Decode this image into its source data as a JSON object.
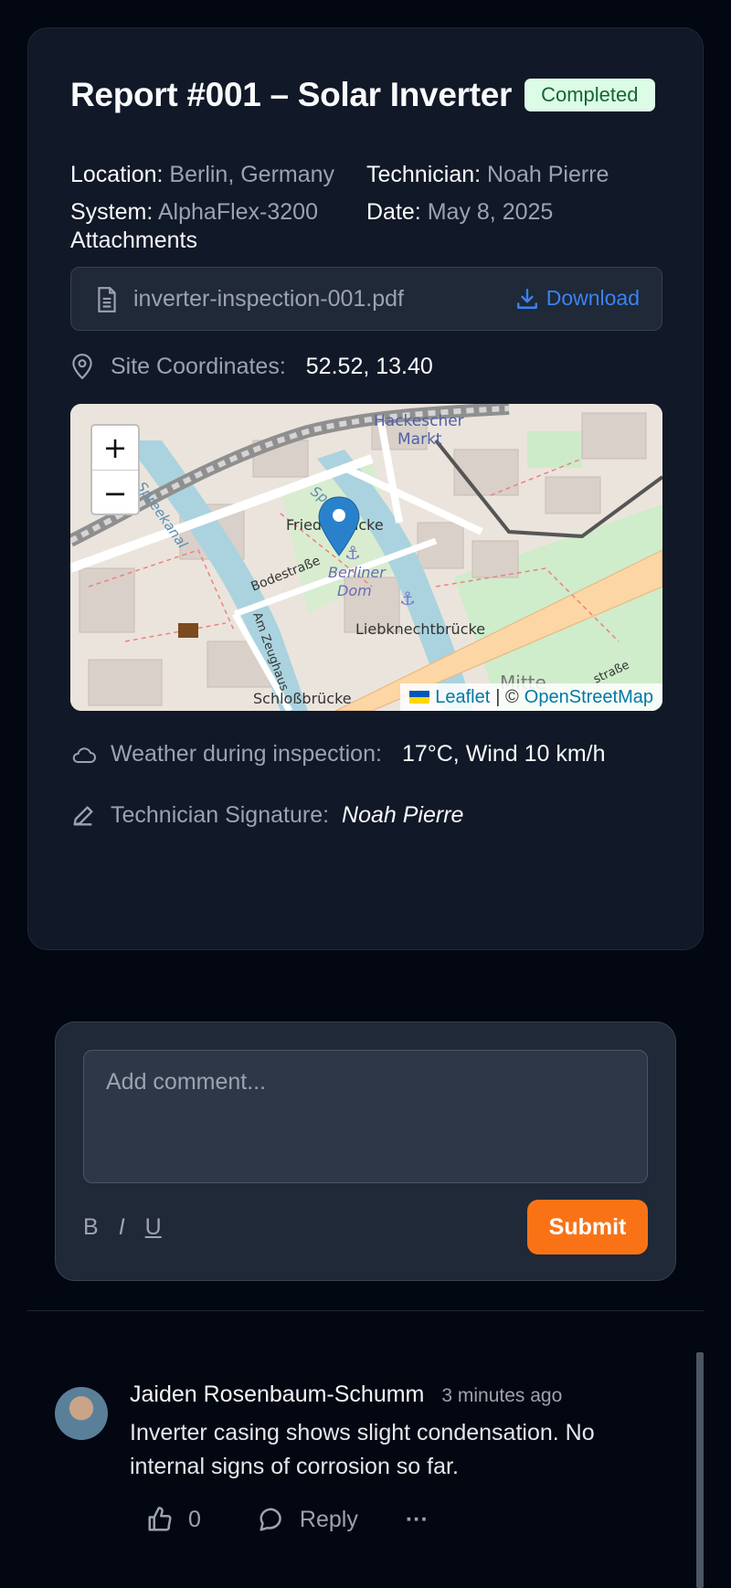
{
  "report": {
    "title": "Report #001 – Solar Inverter",
    "status": "Completed",
    "location_label": "Location:",
    "location": "Berlin, Germany",
    "technician_label": "Technician:",
    "technician": "Noah Pierre",
    "system_label": "System:",
    "system": "AlphaFlex-3200",
    "date_label": "Date:",
    "date": "May 8, 2025",
    "attachments_label": "Attachments",
    "attachment_file": "inverter-inspection-001.pdf",
    "download_label": "Download",
    "coordinates_label": "Site Coordinates:",
    "coordinates": "52.52, 13.40",
    "weather_label": "Weather during inspection:",
    "weather": "17°C, Wind 10 km/h",
    "signature_label": "Technician Signature:",
    "signature": "Noah Pierre"
  },
  "map": {
    "zoom_in": "+",
    "zoom_out": "−",
    "attribution_leaflet": "Leaflet",
    "attribution_sep": "| ©",
    "attribution_osm": "OpenStreetMap",
    "labels": {
      "hackescher": "Hackescher",
      "markt": "Markt",
      "friedrichs": "Fried   sbrücke",
      "berliner": "Berliner",
      "dom": "Dom",
      "liebknecht": "Liebknechtbrücke",
      "bodestrasse": "Bodestraße",
      "zeughaus": "Am Zeughaus",
      "schloss": "Schloßbrücke",
      "spreekanal": "Spreekanal",
      "spree": "Spree",
      "mitte": "Mitte",
      "strasse": "straße"
    }
  },
  "comment_form": {
    "placeholder": "Add comment...",
    "bold": "B",
    "italic": "I",
    "underline": "U",
    "submit": "Submit"
  },
  "comments": [
    {
      "author": "Jaiden Rosenbaum-Schumm",
      "time": "3 minutes ago",
      "text": "Inverter casing shows slight condensation. No internal signs of corrosion so far.",
      "likes": "0",
      "reply": "Reply",
      "more": "···"
    }
  ],
  "colors": {
    "accent": "#f97316",
    "badge_bg": "#dcfce7",
    "badge_text": "#166534",
    "link": "#3b82f6",
    "marker": "#2a81cb"
  },
  "icons": [
    "file-icon",
    "download-icon",
    "map-pin-icon",
    "cloud-icon",
    "pen-icon",
    "thumbs-up-icon",
    "comment-icon",
    "more-icon"
  ]
}
